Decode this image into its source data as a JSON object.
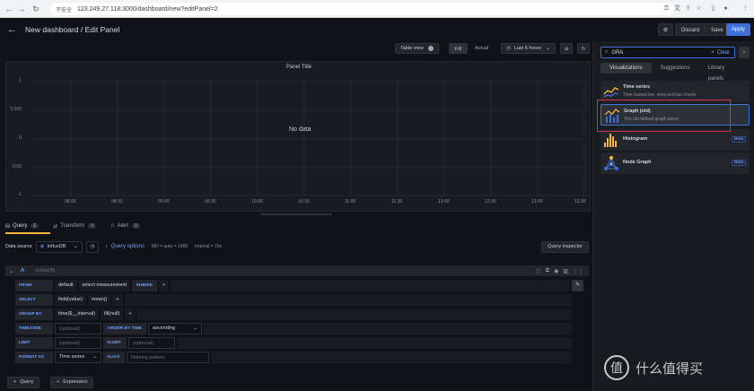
{
  "browser": {
    "security": "不安全",
    "url": "123.249.27.118:3000/dashboard/new?editPanel=2"
  },
  "header": {
    "title": "New dashboard / Edit Panel",
    "discard": "Discard",
    "save": "Save",
    "apply": "Apply"
  },
  "toolbar": {
    "table_view": "Table view",
    "fill": "Fill",
    "actual": "Actual",
    "time_range": "Last 6 hours"
  },
  "panel": {
    "title": "Panel Title",
    "no_data": "No data",
    "y_ticks": [
      "1",
      "0.500",
      "0",
      "-0.50",
      "-1"
    ],
    "x_ticks": [
      "08:00",
      "08:30",
      "09:00",
      "09:30",
      "10:00",
      "10:30",
      "11:00",
      "11:30",
      "12:00",
      "12:30",
      "13:00",
      "13:30"
    ]
  },
  "query_tabs": [
    {
      "label": "Query",
      "count": "1"
    },
    {
      "label": "Transform",
      "count": "0"
    },
    {
      "label": "Alert",
      "count": "0"
    }
  ],
  "datasource": {
    "label": "Data source",
    "name": "InfluxDB",
    "query_options": "Query options",
    "md": "MD = auto = 1458",
    "interval": "Interval = 15s",
    "inspector": "Query inspector"
  },
  "query": {
    "ref": "A",
    "ds": "(InfluxDB)",
    "from_label": "FROM",
    "from_db": "default",
    "from_meas": "select measurement",
    "where": "WHERE",
    "select_label": "SELECT",
    "field": "field(value)",
    "mean": "mean()",
    "groupby_label": "GROUP BY",
    "time": "time($__interval)",
    "fillnull": "fill(null)",
    "timezone_label": "TIMEZONE",
    "optional": "(optional)",
    "orderby_label": "ORDER BY TIME",
    "ascending": "ascending",
    "limit_label": "LIMIT",
    "slimit_label": "SLIMIT",
    "formatas_label": "FORMAT AS",
    "timeseries": "Time series",
    "alias_label": "ALIAS",
    "alias_ph": "Naming pattern",
    "plus": "+",
    "add_query": "Query",
    "add_expression": "Expression"
  },
  "viz": {
    "search_value": "GRA",
    "clear": "Clear",
    "tabs": [
      "Visualizations",
      "Suggestions",
      "Library panels"
    ],
    "cards": [
      {
        "name": "Time series",
        "desc": "Time based line, area and bar charts",
        "beta": ""
      },
      {
        "name": "Graph (old)",
        "desc": "The old default graph panel",
        "beta": ""
      },
      {
        "name": "Histogram",
        "desc": "",
        "beta": "Beta"
      },
      {
        "name": "Node Graph",
        "desc": "",
        "beta": "Beta"
      }
    ]
  },
  "watermark": "值 什么值得买",
  "colors": {
    "accent": "#3d71d9",
    "highlight": "#e02f44",
    "bg": "#111217"
  }
}
